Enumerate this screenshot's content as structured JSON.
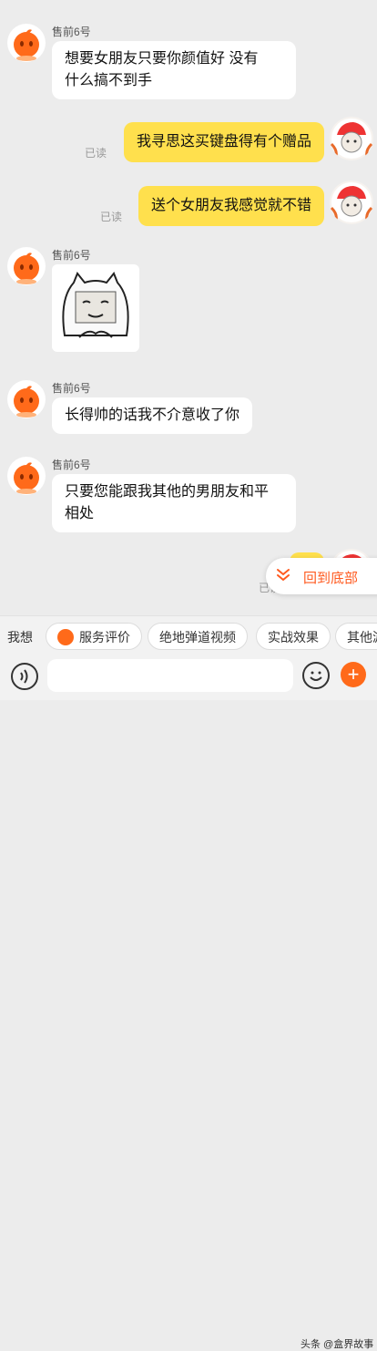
{
  "messages": [
    {
      "side": "left",
      "sender": "售前6号",
      "lines": [
        "想要女朋友只要你颜值好  没有",
        "什么搞不到手"
      ]
    },
    {
      "side": "right",
      "text": "我寻思这买键盘得有个赠品",
      "status": "已读"
    },
    {
      "side": "right",
      "text": "送个女朋友我感觉就不错",
      "status": "已读"
    },
    {
      "side": "left",
      "sender": "售前6号",
      "sticker": "sticker-cat-icon"
    },
    {
      "side": "left",
      "sender": "售前6号",
      "lines": [
        "长得帅的话我不介意收了你"
      ]
    },
    {
      "side": "left",
      "sender": "售前6号",
      "lines": [
        "只要您能跟我其他的男朋友和平",
        "相处"
      ]
    },
    {
      "side": "right",
      "text": "",
      "status": "已读"
    }
  ],
  "back_to_bottom": {
    "label": "回到底部",
    "icon": "chevron-double-down-icon"
  },
  "quick_bar": {
    "lead": "我想",
    "chips": [
      {
        "label": "服务评价",
        "icon": "service-rating-icon"
      },
      {
        "label": "绝地弹道视频"
      },
      {
        "label": "实战效果"
      },
      {
        "label": "其他游"
      }
    ]
  },
  "input_bar": {
    "voice_icon": "voice-icon",
    "emoji_icon": "emoji-icon",
    "plus_icon": "plus-icon",
    "plus_glyph": "+"
  },
  "watermark": "头条 @盒界故事",
  "colors": {
    "accent": "#ff6a1a",
    "bubble_self": "#ffe04d",
    "background": "#ececec"
  }
}
